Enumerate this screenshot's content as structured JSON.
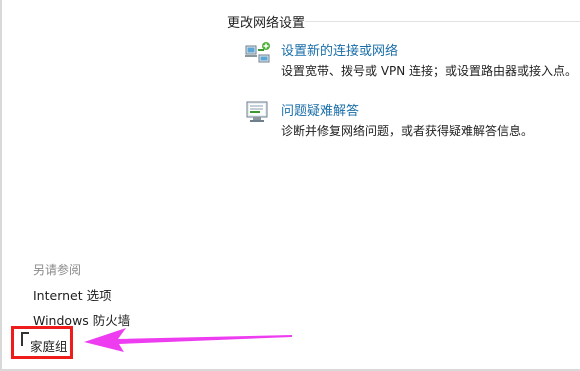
{
  "section": {
    "title": "更改网络设置"
  },
  "tasks": [
    {
      "icon": "network-setup-icon",
      "title": "设置新的连接或网络",
      "description": "设置宽带、拨号或 VPN 连接；或设置路由器或接入点。"
    },
    {
      "icon": "troubleshoot-icon",
      "title": "问题疑难解答",
      "description": "诊断并修复网络问题，或者获得疑难解答信息。"
    }
  ],
  "see_also": {
    "heading": "另请参阅",
    "links": [
      "Internet 选项",
      "Windows 防火墙",
      "家庭组"
    ]
  },
  "annotation": {
    "highlight_color": "#ef1c1c",
    "arrow_color": "#ee3df0"
  }
}
